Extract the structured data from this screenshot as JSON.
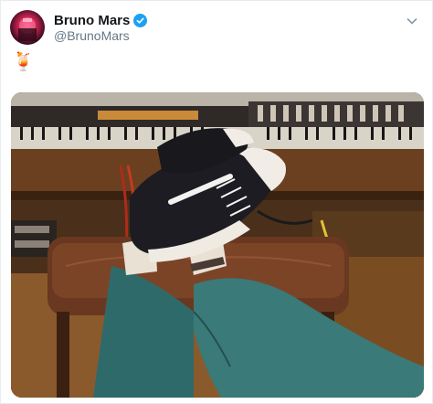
{
  "tweet": {
    "author": {
      "display_name": "Bruno Mars",
      "handle": "@BrunoMars",
      "verified": true,
      "verified_icon": "verified-badge-icon",
      "avatar_icon": "avatar"
    },
    "text": "🍹",
    "menu_icon": "chevron-down-icon",
    "media": {
      "description_icon": "photo"
    }
  },
  "colors": {
    "display_name": "#14171a",
    "handle": "#657786",
    "verified": "#1da1f2",
    "border": "#e6ecf0"
  }
}
